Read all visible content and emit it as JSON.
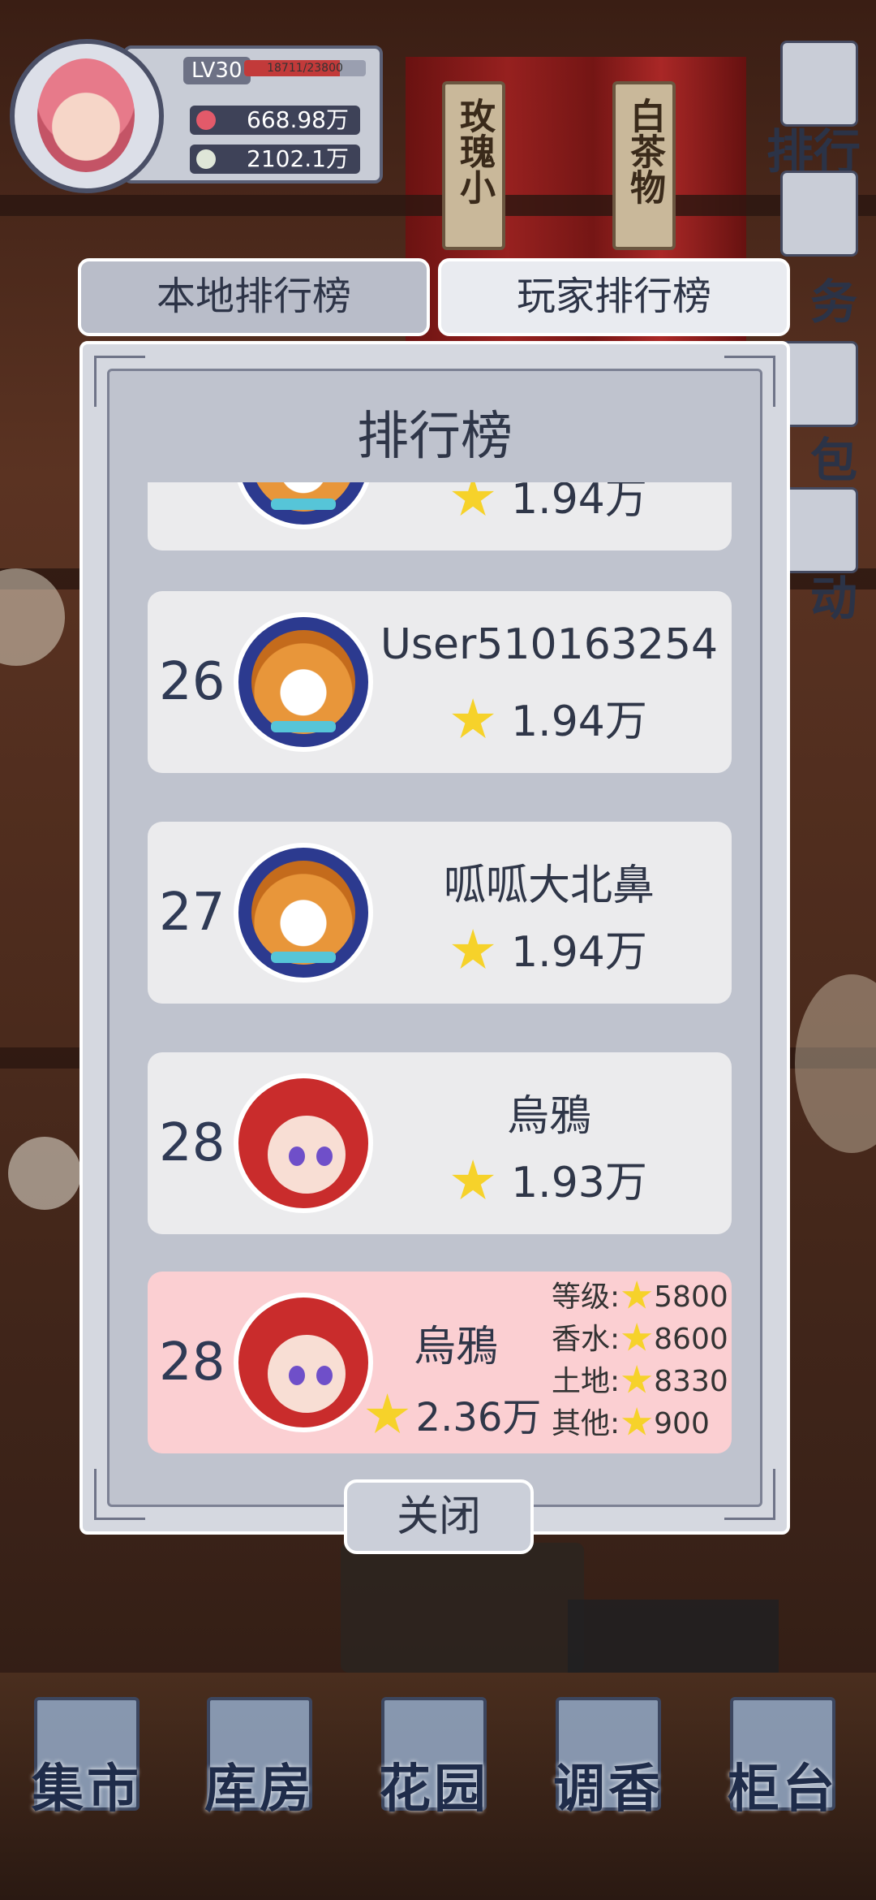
{
  "header": {
    "level": "LV30",
    "exp_text": "18711/23800",
    "exp_fraction": 0.786,
    "currency_primary": "668.98万",
    "currency_secondary": "2102.1万"
  },
  "side_menu": {
    "ranking": "排行",
    "tasks": "务",
    "bag": "包",
    "events": "动"
  },
  "background_tags": [
    "玫瑰小",
    "白茶物"
  ],
  "tabs": [
    {
      "label": "本地排行榜",
      "selected": false
    },
    {
      "label": "玩家排行榜",
      "selected": true
    }
  ],
  "panel": {
    "title": "排行榜",
    "close_label": "关闭",
    "partial_row": {
      "score": "1.94万"
    },
    "rows": [
      {
        "rank": "26",
        "name": "User510163254",
        "score": "1.94万",
        "avatar": "shiba-dog"
      },
      {
        "rank": "27",
        "name": "呱呱大北鼻",
        "score": "1.94万",
        "avatar": "shiba-dog"
      },
      {
        "rank": "28",
        "name": "烏鴉",
        "score": "1.93万",
        "avatar": "red-hair-girl"
      }
    ],
    "my_row": {
      "rank": "28",
      "name": "烏鴉",
      "score": "2.36万",
      "avatar": "red-hair-girl",
      "breakdown": [
        {
          "label": "等级:",
          "value": "5800"
        },
        {
          "label": "香水:",
          "value": "8600"
        },
        {
          "label": "土地:",
          "value": "8330"
        },
        {
          "label": "其他:",
          "value": "900"
        }
      ]
    }
  },
  "bottom_nav": [
    {
      "label": "集市",
      "icon": "market-gate-icon"
    },
    {
      "label": "库房",
      "icon": "warehouse-icon"
    },
    {
      "label": "花园",
      "icon": "rose-icon"
    },
    {
      "label": "调香",
      "icon": "perfume-bottle-icon"
    },
    {
      "label": "柜台",
      "icon": "counter-icon"
    }
  ],
  "colors": {
    "panel_bg": "#d5d8e0",
    "row_bg": "#ebebed",
    "my_row_bg": "#fbcfd2",
    "text_dark": "#2f3648",
    "star": "#f6d22a",
    "exp_fill": "#c23a3a"
  }
}
